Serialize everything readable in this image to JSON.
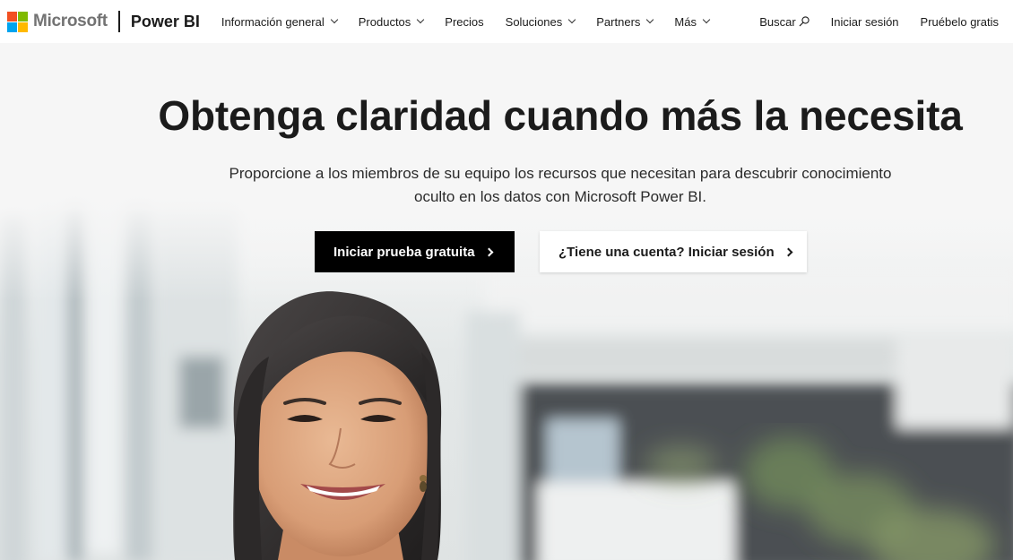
{
  "brand": {
    "company": "Microsoft",
    "product": "Power BI",
    "logo_colors": [
      "#f25022",
      "#7fba00",
      "#00a4ef",
      "#ffb900"
    ]
  },
  "nav": {
    "items": [
      {
        "label": "Información general",
        "dropdown": true
      },
      {
        "label": "Productos",
        "dropdown": true
      },
      {
        "label": "Precios",
        "dropdown": false
      },
      {
        "label": "Soluciones",
        "dropdown": true
      },
      {
        "label": "Partners",
        "dropdown": true
      },
      {
        "label": "Más",
        "dropdown": true
      }
    ],
    "search_label": "Buscar",
    "signin_label": "Iniciar sesión",
    "trial_label": "Pruébelo gratis"
  },
  "hero": {
    "title": "Obtenga claridad cuando más la necesita",
    "subtitle_line1": "Proporcione a los miembros de su equipo los recursos que necesitan para descubrir conocimiento",
    "subtitle_line2": "oculto en los datos con Microsoft Power BI.",
    "primary_cta": "Iniciar prueba gratuita",
    "secondary_cta": "¿Tiene una cuenta? Iniciar sesión"
  },
  "colors": {
    "primary_button_bg": "#000000",
    "text": "#1b1b1b"
  }
}
